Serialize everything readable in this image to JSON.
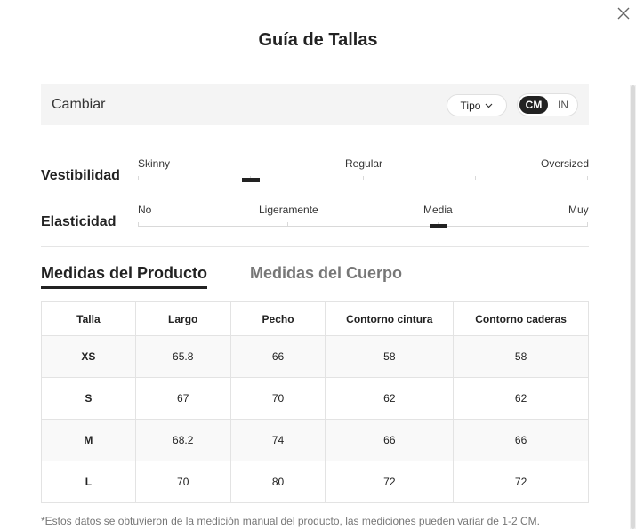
{
  "title": "Guía de Tallas",
  "switch_bar": {
    "label": "Cambiar",
    "type_button": "Tipo",
    "units": {
      "active": "CM",
      "inactive": "IN"
    }
  },
  "fit": {
    "label": "Vestibilidad",
    "ticks": [
      "Skinny",
      "Regular",
      "Oversized"
    ],
    "selected_position": 0.25
  },
  "elasticity": {
    "label": "Elasticidad",
    "ticks": [
      "No",
      "Ligeramente",
      "Media",
      "Muy"
    ],
    "selected_position": 0.667
  },
  "tabs": [
    {
      "label": "Medidas del Producto",
      "active": true
    },
    {
      "label": "Medidas del Cuerpo",
      "active": false
    }
  ],
  "table": {
    "headers": [
      "Talla",
      "Largo",
      "Pecho",
      "Contorno cintura",
      "Contorno caderas"
    ],
    "rows": [
      [
        "XS",
        "65.8",
        "66",
        "58",
        "58"
      ],
      [
        "S",
        "67",
        "70",
        "62",
        "62"
      ],
      [
        "M",
        "68.2",
        "74",
        "66",
        "66"
      ],
      [
        "L",
        "70",
        "80",
        "72",
        "72"
      ]
    ]
  },
  "note": "*Estos datos se obtuvieron de la medición manual del producto, las mediciones pueden variar de 1-2 CM.",
  "icons": {
    "close": "close-icon",
    "dropdown": "chevron-down-icon"
  },
  "colors": {
    "accent": "#222222",
    "bar_bg": "#f4f4f4"
  }
}
